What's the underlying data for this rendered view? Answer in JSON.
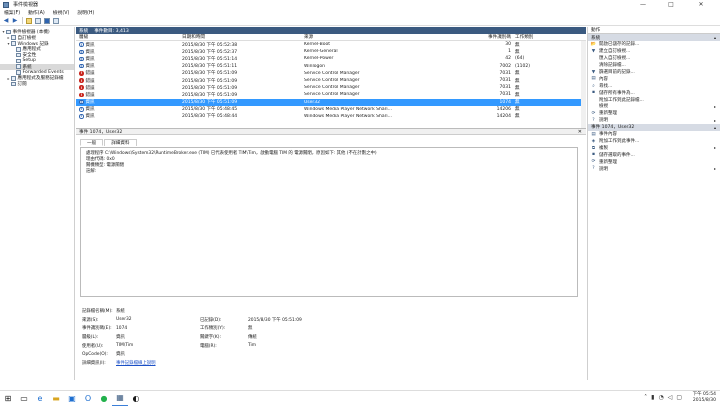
{
  "window": {
    "title": "事件檢視器"
  },
  "controls": {
    "minimize": "—",
    "maximize": "□",
    "close": "✕"
  },
  "menu": [
    "檔案(F)",
    "動作(A)",
    "檢視(V)",
    "說明(H)"
  ],
  "tree": [
    {
      "label": "事件檢視器 (本機)",
      "level": 0,
      "arrow": "▾"
    },
    {
      "label": "自訂檢視",
      "level": 1,
      "arrow": "▸"
    },
    {
      "label": "Windows 記錄",
      "level": 1,
      "arrow": "▾"
    },
    {
      "label": "應用程式",
      "level": 2,
      "arrow": ""
    },
    {
      "label": "安全性",
      "level": 2,
      "arrow": ""
    },
    {
      "label": "Setup",
      "level": 2,
      "arrow": ""
    },
    {
      "label": "系統",
      "level": 2,
      "arrow": "",
      "selected": true
    },
    {
      "label": "Forwarded Events",
      "level": 2,
      "arrow": ""
    },
    {
      "label": "應用程式及服務記錄檔",
      "level": 1,
      "arrow": "▸"
    },
    {
      "label": "訂閱",
      "level": 1,
      "arrow": ""
    }
  ],
  "list": {
    "header": "系統",
    "count": "事件數目: 3,413",
    "columns": [
      "層級",
      "日期和時間",
      "來源",
      "事件識別碼",
      "工作類別"
    ],
    "rows": [
      {
        "level": "資訊",
        "type": "info",
        "date": "2015/8/30 下午 05:52:38",
        "source": "Kernel-Boot",
        "id": "30",
        "task": "無"
      },
      {
        "level": "資訊",
        "type": "info",
        "date": "2015/8/30 下午 05:52:37",
        "source": "Kernel-General",
        "id": "1",
        "task": "無"
      },
      {
        "level": "資訊",
        "type": "info",
        "date": "2015/8/30 下午 05:51:14",
        "source": "Kernel-Power",
        "id": "42",
        "task": "(64)"
      },
      {
        "level": "資訊",
        "type": "info",
        "date": "2015/8/30 下午 05:51:11",
        "source": "Winlogon",
        "id": "7002",
        "task": "(1102)"
      },
      {
        "level": "錯誤",
        "type": "err",
        "date": "2015/8/30 下午 05:51:09",
        "source": "Service Control Manager",
        "id": "7031",
        "task": "無"
      },
      {
        "level": "錯誤",
        "type": "err",
        "date": "2015/8/30 下午 05:51:09",
        "source": "Service Control Manager",
        "id": "7031",
        "task": "無"
      },
      {
        "level": "錯誤",
        "type": "err",
        "date": "2015/8/30 下午 05:51:09",
        "source": "Service Control Manager",
        "id": "7031",
        "task": "無"
      },
      {
        "level": "錯誤",
        "type": "err",
        "date": "2015/8/30 下午 05:51:09",
        "source": "Service Control Manager",
        "id": "7031",
        "task": "無"
      },
      {
        "level": "資訊",
        "type": "info",
        "date": "2015/8/30 下午 05:51:09",
        "source": "User32",
        "id": "1074",
        "task": "無",
        "selected": true
      },
      {
        "level": "資訊",
        "type": "info",
        "date": "2015/8/30 下午 05:48:45",
        "source": "Windows Media Player Network Shari...",
        "id": "14206",
        "task": "無"
      },
      {
        "level": "資訊",
        "type": "info",
        "date": "2015/8/30 下午 05:48:44",
        "source": "Windows Media Player Network Shari...",
        "id": "14204",
        "task": "無"
      }
    ]
  },
  "detail": {
    "title": "事件 1074，User32",
    "tabs": [
      "一般",
      "詳細資料"
    ],
    "message_lines": [
      "處理程序 C:\\Windows\\System32\\RuntimeBroker.exe (TIM) 已代表使用者 TIM\\Tim，啟動電腦 TIM 的 電源關閉，原因如下: 其他 (不在計劃之中)",
      "理由代碼: 0x0",
      "關機類型: 電源關閉",
      "註解:"
    ],
    "props": [
      {
        "k1": "記錄檔名稱(M):",
        "v1": "系統",
        "k2": "",
        "v2": ""
      },
      {
        "k1": "來源(S):",
        "v1": "User32",
        "k2": "已記錄(D):",
        "v2": "2015/8/30 下午 05:51:09"
      },
      {
        "k1": "事件識別碼(E):",
        "v1": "1074",
        "k2": "工作類別(Y):",
        "v2": "無"
      },
      {
        "k1": "層級(L):",
        "v1": "資訊",
        "k2": "關鍵字(K):",
        "v2": "傳統"
      },
      {
        "k1": "使用者(U):",
        "v1": "TIM\\Tim",
        "k2": "電腦(R):",
        "v2": "Tim"
      },
      {
        "k1": "OpCode(O):",
        "v1": "資訊",
        "k2": "",
        "v2": ""
      },
      {
        "k1": "詳細資訊(I):",
        "v1": "事件記錄檔線上說明",
        "k2": "",
        "v2": "",
        "link": true
      }
    ]
  },
  "actions": {
    "header": "動作",
    "section1": "系統",
    "items1": [
      {
        "icon": "folder-open-icon",
        "glyph": "📂",
        "label": "開啟已儲存的記錄...",
        "arrow": ""
      },
      {
        "icon": "filter-icon",
        "glyph": "▼",
        "label": "建立自訂檢視...",
        "arrow": ""
      },
      {
        "icon": "",
        "glyph": "",
        "label": "匯入自訂檢視...",
        "arrow": ""
      },
      {
        "icon": "",
        "glyph": "",
        "label": "清除記錄檔...",
        "arrow": ""
      },
      {
        "icon": "filter-icon",
        "glyph": "▼",
        "label": "篩選目前的記錄...",
        "arrow": ""
      },
      {
        "icon": "properties-icon",
        "glyph": "▤",
        "label": "內容",
        "arrow": ""
      },
      {
        "icon": "find-icon",
        "glyph": "⌕",
        "label": "尋找...",
        "arrow": ""
      },
      {
        "icon": "save-icon",
        "glyph": "▪",
        "label": "儲存所有事件為...",
        "arrow": ""
      },
      {
        "icon": "",
        "glyph": "",
        "label": "附加工作到此記錄檔...",
        "arrow": ""
      },
      {
        "icon": "",
        "glyph": "",
        "label": "檢視",
        "arrow": "▸"
      },
      {
        "icon": "refresh-icon",
        "glyph": "⟳",
        "label": "重新整理",
        "arrow": ""
      },
      {
        "icon": "help-icon",
        "glyph": "?",
        "label": "說明",
        "arrow": "▸"
      }
    ],
    "section2": "事件 1074，User32",
    "items2": [
      {
        "icon": "event-properties-icon",
        "glyph": "▤",
        "label": "事件內容",
        "arrow": ""
      },
      {
        "icon": "task-icon",
        "glyph": "◈",
        "label": "附加工作到此事件...",
        "arrow": ""
      },
      {
        "icon": "copy-icon",
        "glyph": "⧉",
        "label": "複製",
        "arrow": "▸"
      },
      {
        "icon": "save-icon",
        "glyph": "▪",
        "label": "儲存選取的事件...",
        "arrow": ""
      },
      {
        "icon": "refresh-icon",
        "glyph": "⟳",
        "label": "重新整理",
        "arrow": ""
      },
      {
        "icon": "help-icon",
        "glyph": "?",
        "label": "說明",
        "arrow": "▸"
      }
    ]
  },
  "taskbar": {
    "time": "下午 05:54",
    "date": "2015/8/30"
  }
}
